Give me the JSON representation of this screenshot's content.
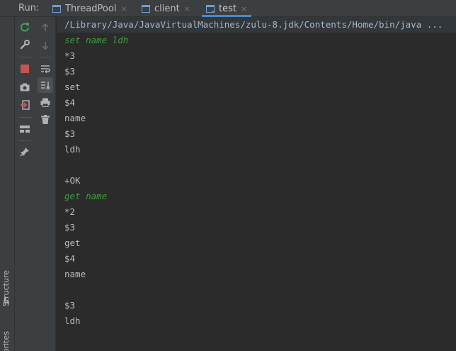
{
  "run_panel": {
    "label": "Run:",
    "tabs": [
      {
        "label": "ThreadPool",
        "icon": "application-run-icon",
        "active": false
      },
      {
        "label": "client",
        "icon": "application-run-icon",
        "active": false
      },
      {
        "label": "test",
        "icon": "application-run-icon",
        "active": true
      }
    ],
    "close_glyph": "×"
  },
  "left_strip": {
    "structure_label": "Structure",
    "favorites_label": "Favorites"
  },
  "toolbar": {
    "primary": [
      "rerun-icon",
      "wrench-icon",
      "stop-icon",
      "camera-icon",
      "exit-icon",
      "layout-icon",
      "pin-icon"
    ],
    "secondary": [
      "up-arrow-icon",
      "down-arrow-icon",
      "soft-wrap-icon",
      "scroll-to-end-icon",
      "print-icon",
      "trash-icon"
    ]
  },
  "console": {
    "lines": [
      {
        "text": "/Library/Java/JavaVirtualMachines/zulu-8.jdk/Contents/Home/bin/java ...",
        "kind": "cmd"
      },
      {
        "text": "set name ldh",
        "kind": "input"
      },
      {
        "text": "*3",
        "kind": "output"
      },
      {
        "text": "$3",
        "kind": "output"
      },
      {
        "text": "set",
        "kind": "output"
      },
      {
        "text": "$4",
        "kind": "output"
      },
      {
        "text": "name",
        "kind": "output"
      },
      {
        "text": "$3",
        "kind": "output"
      },
      {
        "text": "ldh",
        "kind": "output"
      },
      {
        "text": "",
        "kind": "output"
      },
      {
        "text": "+OK",
        "kind": "output"
      },
      {
        "text": "get name",
        "kind": "input"
      },
      {
        "text": "*2",
        "kind": "output"
      },
      {
        "text": "$3",
        "kind": "output"
      },
      {
        "text": "get",
        "kind": "output"
      },
      {
        "text": "$4",
        "kind": "output"
      },
      {
        "text": "name",
        "kind": "output"
      },
      {
        "text": "",
        "kind": "output"
      },
      {
        "text": "$3",
        "kind": "output"
      },
      {
        "text": "ldh",
        "kind": "output"
      }
    ]
  },
  "colors": {
    "background": "#2b2b2b",
    "panel": "#3c3f41",
    "text": "#bbbbbb",
    "user_input": "#3f9a3f",
    "active_tab_underline": "#4a88c7",
    "stop": "#c75450",
    "rerun": "#499c54"
  }
}
